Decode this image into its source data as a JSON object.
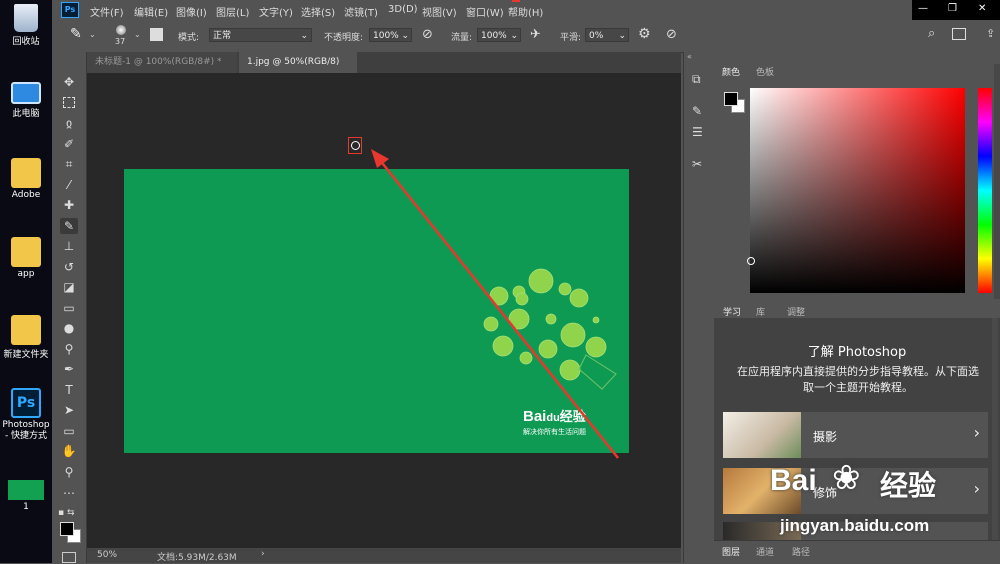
{
  "desktop": {
    "icons": [
      {
        "label": "回收站"
      },
      {
        "label": "此电脑"
      },
      {
        "label": "Adobe"
      },
      {
        "label": "app"
      },
      {
        "label": "新建文件夹"
      },
      {
        "label": "Photoshop - 快捷方式"
      },
      {
        "label": "1"
      }
    ]
  },
  "menubar": {
    "logo": "Ps",
    "items": [
      "文件(F)",
      "编辑(E)",
      "图像(I)",
      "图层(L)",
      "文字(Y)",
      "选择(S)",
      "滤镜(T)",
      "3D(D)",
      "视图(V)",
      "窗口(W)",
      "帮助(H)"
    ],
    "window_controls": [
      "—",
      "❐",
      "✕"
    ]
  },
  "optbar": {
    "brush_size": "37",
    "mode_label": "模式:",
    "mode_value": "正常",
    "opacity_label": "不透明度:",
    "opacity_value": "100%",
    "flow_label": "流量:",
    "flow_value": "100%",
    "smooth_label": "平滑:",
    "smooth_value": "0%"
  },
  "tabs": [
    {
      "label": "未标题-1 @ 100%(RGB/8#) *",
      "close": "×"
    },
    {
      "label": "1.jpg @ 50%(RGB/8)",
      "close": "×"
    }
  ],
  "status": {
    "zoom": "50%",
    "doc": "文档:5.93M/2.63M",
    "arrow": "›"
  },
  "canvas": {
    "bg_color": "#0e9a53",
    "brand_bai": "Bai",
    "brand_du": "du",
    "brand_jy": "经验",
    "slogan": "解决你所有生活问题"
  },
  "color_panel": {
    "tabs": [
      "颜色",
      "色板"
    ]
  },
  "learn_panel": {
    "tabs": [
      "学习",
      "库",
      "调整"
    ],
    "heading": "了解 Photoshop",
    "description": "在应用程序内直接提供的分步指导教程。从下面选取一个主题开始教程。",
    "cards": [
      {
        "title": "摄影",
        "arrow": "›"
      },
      {
        "title": "修饰",
        "arrow": "›"
      }
    ]
  },
  "bottom_tabs": [
    "图层",
    "通道",
    "路径"
  ],
  "watermark": {
    "text_a": "Bai",
    "text_b": "经验",
    "url": "jingyan.baidu.com"
  },
  "colors": {
    "accent_red": "#e8372f",
    "ps_blue": "#31a8ff"
  }
}
